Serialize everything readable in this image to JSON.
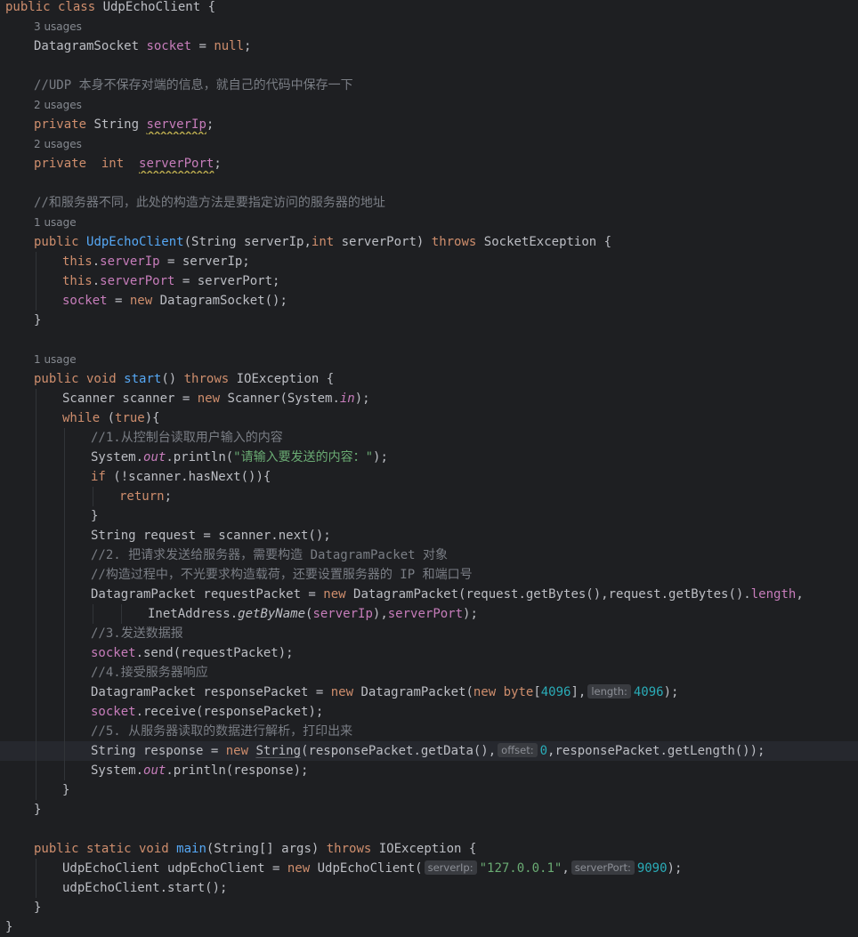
{
  "editor": {
    "lines": [
      {
        "indent": 0,
        "tokens": [
          {
            "t": "public class ",
            "c": "kw"
          },
          {
            "t": "UdpEchoClient {"
          }
        ]
      },
      {
        "indent": 1,
        "hint": "3 usages"
      },
      {
        "indent": 1,
        "tokens": [
          {
            "t": "DatagramSocket "
          },
          {
            "t": "socket",
            "c": "fld"
          },
          {
            "t": " = "
          },
          {
            "t": "null",
            "c": "kw"
          },
          {
            "t": ";"
          }
        ]
      },
      {
        "indent": 1,
        "tokens": []
      },
      {
        "indent": 1,
        "tokens": [
          {
            "t": "//UDP 本身不保存对端的信息，就自己的代码中保存一下",
            "c": "cm"
          }
        ]
      },
      {
        "indent": 1,
        "hint": "2 usages"
      },
      {
        "indent": 1,
        "tokens": [
          {
            "t": "private ",
            "c": "kw"
          },
          {
            "t": "String "
          },
          {
            "t": "serverIp",
            "c": "fld und"
          },
          {
            "t": ";"
          }
        ]
      },
      {
        "indent": 1,
        "hint": "2 usages"
      },
      {
        "indent": 1,
        "tokens": [
          {
            "t": "private  int  ",
            "c": "kw"
          },
          {
            "t": "serverPort",
            "c": "fld und"
          },
          {
            "t": ";"
          }
        ]
      },
      {
        "indent": 1,
        "tokens": []
      },
      {
        "indent": 1,
        "tokens": [
          {
            "t": "//和服务器不同，此处的构造方法是要指定访问的服务器的地址",
            "c": "cm"
          }
        ]
      },
      {
        "indent": 1,
        "hint": "1 usage"
      },
      {
        "indent": 1,
        "tokens": [
          {
            "t": "public ",
            "c": "kw"
          },
          {
            "t": "UdpEchoClient",
            "c": "fn"
          },
          {
            "t": "(String serverIp,"
          },
          {
            "t": "int ",
            "c": "kw"
          },
          {
            "t": "serverPort) "
          },
          {
            "t": "throws ",
            "c": "kw"
          },
          {
            "t": "SocketException {"
          }
        ]
      },
      {
        "indent": 2,
        "tokens": [
          {
            "t": "this",
            "c": "kw"
          },
          {
            "t": "."
          },
          {
            "t": "serverIp",
            "c": "fld"
          },
          {
            "t": " = serverIp;"
          }
        ]
      },
      {
        "indent": 2,
        "tokens": [
          {
            "t": "this",
            "c": "kw"
          },
          {
            "t": "."
          },
          {
            "t": "serverPort",
            "c": "fld"
          },
          {
            "t": " = serverPort;"
          }
        ]
      },
      {
        "indent": 2,
        "tokens": [
          {
            "t": "socket",
            "c": "fld"
          },
          {
            "t": " = "
          },
          {
            "t": "new ",
            "c": "kw"
          },
          {
            "t": "DatagramSocket();"
          }
        ]
      },
      {
        "indent": 1,
        "tokens": [
          {
            "t": "}"
          }
        ]
      },
      {
        "indent": 1,
        "tokens": []
      },
      {
        "indent": 1,
        "hint": "1 usage"
      },
      {
        "indent": 1,
        "tokens": [
          {
            "t": "public void ",
            "c": "kw"
          },
          {
            "t": "start",
            "c": "fn"
          },
          {
            "t": "() "
          },
          {
            "t": "throws ",
            "c": "kw"
          },
          {
            "t": "IOException {"
          }
        ]
      },
      {
        "indent": 2,
        "tokens": [
          {
            "t": "Scanner scanner = "
          },
          {
            "t": "new ",
            "c": "kw"
          },
          {
            "t": "Scanner(System."
          },
          {
            "t": "in",
            "c": "fld it"
          },
          {
            "t": ");"
          }
        ]
      },
      {
        "indent": 2,
        "tokens": [
          {
            "t": "while ",
            "c": "kw"
          },
          {
            "t": "("
          },
          {
            "t": "true",
            "c": "kw"
          },
          {
            "t": "){"
          }
        ]
      },
      {
        "indent": 3,
        "tokens": [
          {
            "t": "//1.从控制台读取用户输入的内容",
            "c": "cm"
          }
        ]
      },
      {
        "indent": 3,
        "tokens": [
          {
            "t": "System."
          },
          {
            "t": "out",
            "c": "fld it"
          },
          {
            "t": ".println("
          },
          {
            "t": "\"请输入要发送的内容：\"",
            "c": "str"
          },
          {
            "t": ");"
          }
        ]
      },
      {
        "indent": 3,
        "tokens": [
          {
            "t": "if ",
            "c": "kw"
          },
          {
            "t": "(!scanner.hasNext()){"
          }
        ]
      },
      {
        "indent": 4,
        "tokens": [
          {
            "t": "return",
            "c": "kw"
          },
          {
            "t": ";"
          }
        ]
      },
      {
        "indent": 3,
        "tokens": [
          {
            "t": "}"
          }
        ]
      },
      {
        "indent": 3,
        "tokens": [
          {
            "t": "String request = scanner.next();"
          }
        ]
      },
      {
        "indent": 3,
        "tokens": [
          {
            "t": "//2. 把请求发送给服务器，需要构造 DatagramPacket 对象",
            "c": "cm"
          }
        ]
      },
      {
        "indent": 3,
        "tokens": [
          {
            "t": "//构造过程中，不光要求构造载荷，还要设置服务器的 IP 和端口号",
            "c": "cm"
          }
        ]
      },
      {
        "indent": 3,
        "tokens": [
          {
            "t": "DatagramPacket requestPacket = "
          },
          {
            "t": "new ",
            "c": "kw"
          },
          {
            "t": "DatagramPacket(request.getBytes(),request.getBytes()."
          },
          {
            "t": "length",
            "c": "fld"
          },
          {
            "t": ","
          }
        ]
      },
      {
        "indent": 5,
        "tokens": [
          {
            "t": "InetAddress."
          },
          {
            "t": "getByName",
            "c": "it"
          },
          {
            "t": "("
          },
          {
            "t": "serverIp",
            "c": "fld"
          },
          {
            "t": "),"
          },
          {
            "t": "serverPort",
            "c": "fld"
          },
          {
            "t": ");"
          }
        ]
      },
      {
        "indent": 3,
        "tokens": [
          {
            "t": "//3.发送数据报",
            "c": "cm"
          }
        ]
      },
      {
        "indent": 3,
        "tokens": [
          {
            "t": "socket",
            "c": "fld"
          },
          {
            "t": ".send(requestPacket);"
          }
        ]
      },
      {
        "indent": 3,
        "tokens": [
          {
            "t": "//4.接受服务器响应",
            "c": "cm"
          }
        ]
      },
      {
        "indent": 3,
        "tokens": [
          {
            "t": "DatagramPacket responsePacket = "
          },
          {
            "t": "new ",
            "c": "kw"
          },
          {
            "t": "DatagramPacket("
          },
          {
            "t": "new byte",
            "c": "kw"
          },
          {
            "t": "["
          },
          {
            "t": "4096",
            "c": "num"
          },
          {
            "t": "],"
          },
          {
            "p": "length:"
          },
          {
            "t": "4096",
            "c": "num"
          },
          {
            "t": ");"
          }
        ]
      },
      {
        "indent": 3,
        "tokens": [
          {
            "t": "socket",
            "c": "fld"
          },
          {
            "t": ".receive(responsePacket);"
          }
        ]
      },
      {
        "indent": 3,
        "tokens": [
          {
            "t": "//5. 从服务器读取的数据进行解析，打印出来",
            "c": "cm"
          }
        ]
      },
      {
        "indent": 3,
        "current": true,
        "tokens": [
          {
            "t": "String response = "
          },
          {
            "t": "new ",
            "c": "kw"
          },
          {
            "t": "String",
            "c": "ul"
          },
          {
            "t": "(responsePacket.getData(),"
          },
          {
            "p": "offset:"
          },
          {
            "t": "0",
            "c": "num"
          },
          {
            "t": ",responsePacket.getLength());"
          }
        ]
      },
      {
        "indent": 3,
        "tokens": [
          {
            "t": "System."
          },
          {
            "t": "out",
            "c": "fld it"
          },
          {
            "t": ".println(response);"
          }
        ]
      },
      {
        "indent": 2,
        "tokens": [
          {
            "t": "}"
          }
        ]
      },
      {
        "indent": 1,
        "tokens": [
          {
            "t": "}"
          }
        ]
      },
      {
        "indent": 1,
        "tokens": []
      },
      {
        "indent": 1,
        "tokens": [
          {
            "t": "public static void ",
            "c": "kw"
          },
          {
            "t": "main",
            "c": "fn"
          },
          {
            "t": "(String[] args) "
          },
          {
            "t": "throws ",
            "c": "kw"
          },
          {
            "t": "IOException {"
          }
        ]
      },
      {
        "indent": 2,
        "tokens": [
          {
            "t": "UdpEchoClient udpEchoClient = "
          },
          {
            "t": "new ",
            "c": "kw"
          },
          {
            "t": "UdpEchoClient("
          },
          {
            "p": "serverIp:"
          },
          {
            "t": "\"127.0.0.1\"",
            "c": "str"
          },
          {
            "t": ","
          },
          {
            "p": "serverPort:"
          },
          {
            "t": "9090",
            "c": "num"
          },
          {
            "t": ");"
          }
        ]
      },
      {
        "indent": 2,
        "tokens": [
          {
            "t": "udpEchoClient.start();"
          }
        ]
      },
      {
        "indent": 1,
        "tokens": [
          {
            "t": "}"
          }
        ]
      },
      {
        "indent": 0,
        "tokens": [
          {
            "t": "}"
          }
        ]
      }
    ]
  }
}
